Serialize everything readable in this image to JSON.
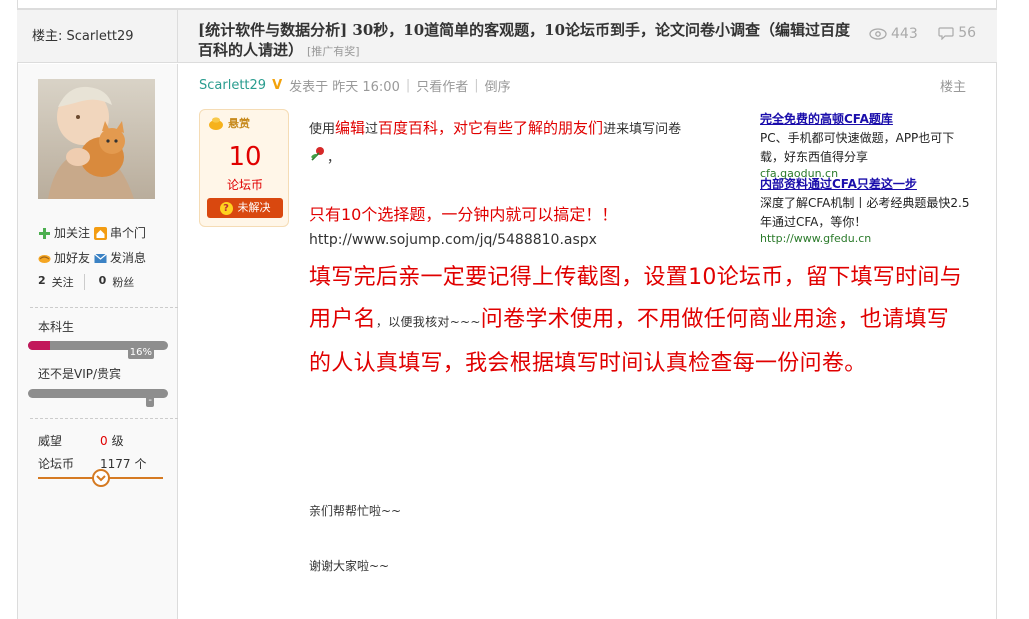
{
  "header": {
    "owner_label": "楼主: Scarlett29",
    "title": "[统计软件与数据分析] 30秒，10道简单的客观题，10论坛币到手，论文问卷小调查（编辑过百度百科的人请进）",
    "promo_tag": "[推广有奖]",
    "views": "443",
    "replies": "56"
  },
  "sidebar": {
    "follow_label": "加关注",
    "visit_label": "串个门",
    "add_friend_label": "加好友",
    "message_label": "发消息",
    "following_count": "2",
    "following_label": "关注",
    "fans_count": "0",
    "fans_label": "粉丝",
    "rank_name": "本科生",
    "rank_progress": 0.16,
    "rank_progress_label": "16%",
    "vip_label": "还不是VIP/贵宾",
    "vip_progress_label": "-",
    "prestige_label": "威望",
    "prestige_value": "0",
    "prestige_unit": "级",
    "coins_label": "论坛币",
    "coins_value": "1177",
    "coins_unit": "个"
  },
  "post": {
    "author": "Scarlett29",
    "vip_badge": "V",
    "posted": "发表于 昨天 16:00",
    "only_author": "只看作者",
    "reverse": "倒序",
    "floor": "楼主",
    "bounty": {
      "header": "悬赏",
      "amount": "10",
      "unit": "论坛币",
      "status": "未解决"
    },
    "intro_pre": "使用",
    "intro_edit": "编辑",
    "intro_mid": "过",
    "intro_baike": "百度百科，对它有些了解的朋友们",
    "intro_post": "进来填写问卷",
    "intro_end": "，",
    "only_ten": "只有10个选择题，一分钟内就可以搞定！！",
    "url": "http://www.sojump.com/jq/5488810.aspx",
    "big_1": "填写完后亲一定要记得上传截图，设置10论坛币，留下填写时间与用户名",
    "big_small": "，以便我核对~~~",
    "big_2": "问卷学术使用，不用做任何商业用途，也请填写的人认真填写，我会根据填写时间认真检查每一份问卷。",
    "thanks_1": "亲们帮帮忙啦~~",
    "thanks_2": "谢谢大家啦~~"
  },
  "ads": [
    {
      "title": "完全免费的高顿CFA题库",
      "desc": "PC、手机都可快速做题，APP也可下载，好东西值得分享",
      "url": "cfa.gaodun.cn"
    },
    {
      "title": "内部资料通过CFA只差这一步",
      "desc": "深度了解CFA机制丨必考经典题最快2.5年通过CFA，等你！",
      "url": "http://www.gfedu.cn"
    }
  ],
  "colors": {
    "accent_red": "#e00000",
    "author_green": "#2a9d8f",
    "bounty_orange": "#d9480f",
    "rank_magenta": "#c2185b"
  }
}
